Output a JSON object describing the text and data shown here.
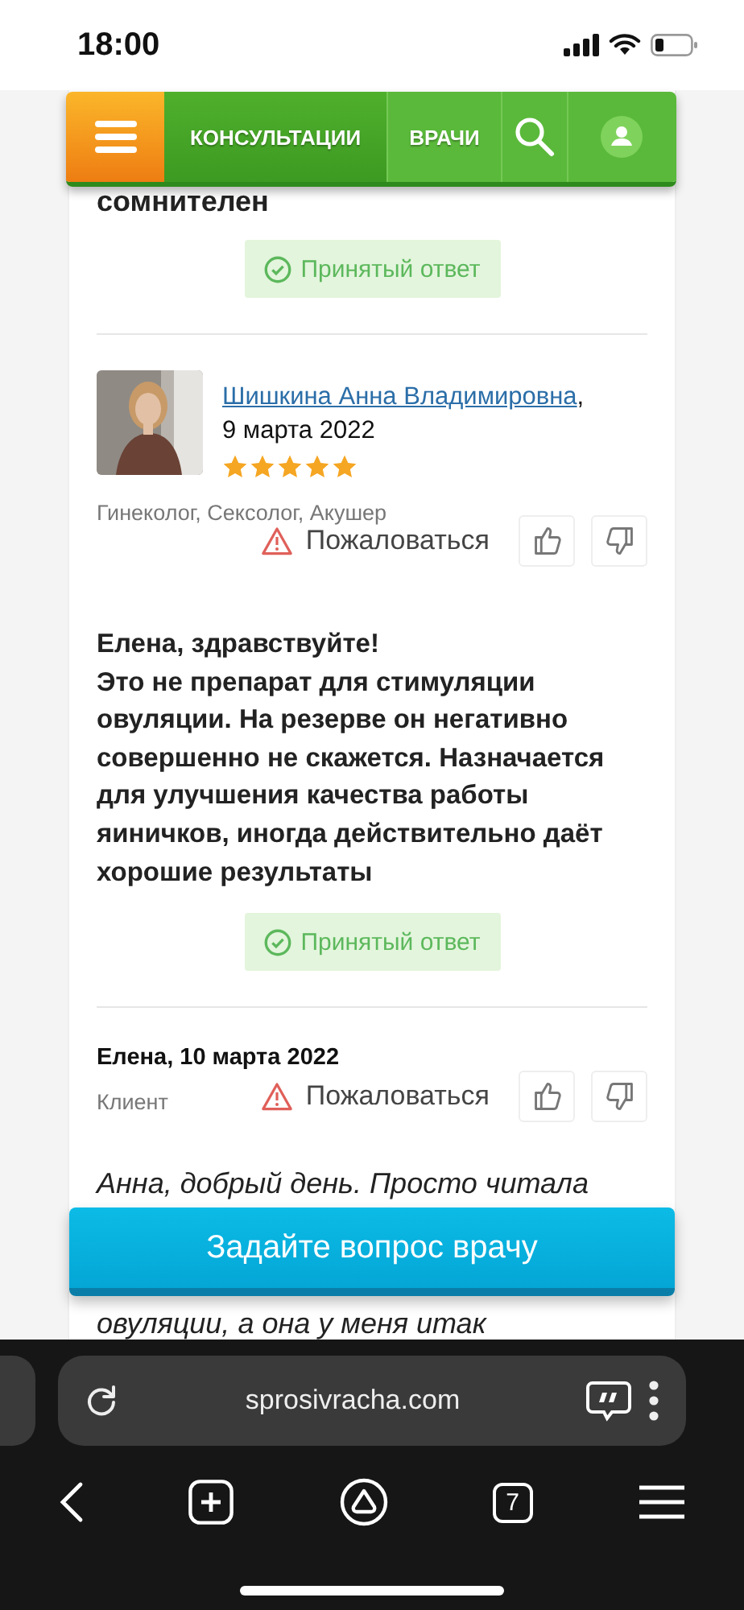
{
  "status_bar": {
    "time": "18:00"
  },
  "nav": {
    "items": [
      {
        "label": "КОНСУЛЬТАЦИИ",
        "selected": true
      },
      {
        "label": "ВРАЧИ",
        "selected": false
      }
    ]
  },
  "previous_answer": {
    "text_tail": "сомнителен",
    "badge": "Принятый ответ"
  },
  "doctor_answer": {
    "name": "Шишкина Анна Владимировна",
    "name_suffix": ",",
    "date": "9 марта 2022",
    "stars": 5,
    "specialties": "Гинеколог, Сексолог, Акушер",
    "complaint": "Пожаловаться",
    "text": "Елена, здравствуйте!\nЭто не препарат для стимуляции овуляции. На резерве он негативно совершенно не скажется. Назначается для улучшения качества работы яиничков, иногда действительно даёт хорошие результаты",
    "badge": "Принятый ответ"
  },
  "client_comment": {
    "author": "Елена, 10 марта 2022",
    "role": "Клиент",
    "complaint": "Пожаловаться",
    "text_lines": [
      "Анна, добрый день. Просто читала",
      "овуляции, а она у меня итак"
    ]
  },
  "ask_button": "Задайте вопрос врачу",
  "browser": {
    "url": "sprosivracha.com",
    "tab_count": "7"
  }
}
